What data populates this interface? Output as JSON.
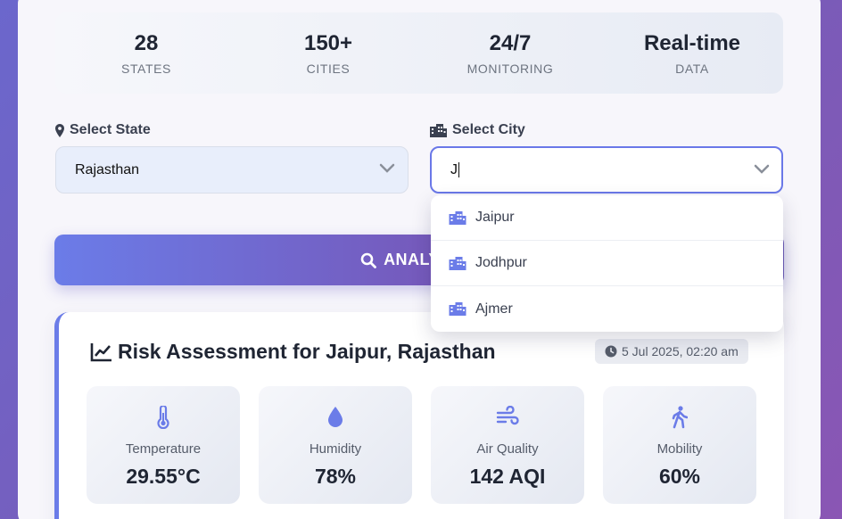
{
  "stats": [
    {
      "value": "28",
      "label": "STATES"
    },
    {
      "value": "150+",
      "label": "CITIES"
    },
    {
      "value": "24/7",
      "label": "MONITORING"
    },
    {
      "value": "Real-time",
      "label": "DATA"
    }
  ],
  "state_field": {
    "label": "Select State",
    "value": "Rajasthan",
    "icon": "map-marker-icon"
  },
  "city_field": {
    "label": "Select City",
    "value": "J",
    "icon": "building-icon"
  },
  "city_suggestions": [
    "Jaipur",
    "Jodhpur",
    "Ajmer"
  ],
  "analyze_button": {
    "label": "ANALYZE R",
    "icon": "search-icon"
  },
  "result": {
    "title": "Risk Assessment for Jaipur, Rajasthan",
    "timestamp": "5 Jul 2025, 02:20 am",
    "metrics": [
      {
        "label": "Temperature",
        "value": "29.55°C",
        "icon": "thermometer-icon"
      },
      {
        "label": "Humidity",
        "value": "78%",
        "icon": "droplet-icon"
      },
      {
        "label": "Air Quality",
        "value": "142 AQI",
        "icon": "wind-icon"
      },
      {
        "label": "Mobility",
        "value": "60%",
        "icon": "walking-icon"
      }
    ]
  },
  "colors": {
    "accent": "#6b7ce8",
    "accent_dark": "#7657b8",
    "text": "#1f2533",
    "muted": "#6d7480"
  }
}
